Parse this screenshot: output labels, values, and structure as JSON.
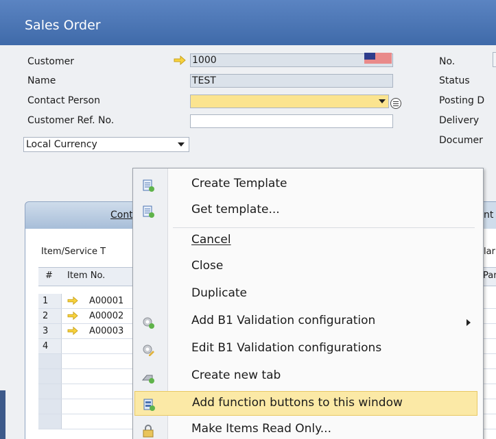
{
  "window": {
    "title": "Sales Order"
  },
  "header": {
    "customer_label": "Customer",
    "customer_value": "1000",
    "name_label": "Name",
    "name_value": "TEST",
    "contact_label": "Contact Person",
    "contact_value": "",
    "custref_label": "Customer Ref. No.",
    "custref_value": "",
    "currency_value": "Local Currency"
  },
  "right": {
    "no_label": "No.",
    "status_label": "Status",
    "posting_label": "Posting D",
    "delivery_label": "Delivery",
    "document_label": "Documer"
  },
  "tabs": {
    "contents_label": "Cont",
    "tab2_label": "nt"
  },
  "grid": {
    "item_service_label": "Item/Service T",
    "col_hash": "#",
    "col_item": "Item No.",
    "right_hdr_1": "lar",
    "right_hdr_2": "Par",
    "rows": [
      {
        "num": "1",
        "item": "A00001"
      },
      {
        "num": "2",
        "item": "A00002"
      },
      {
        "num": "3",
        "item": "A00003"
      },
      {
        "num": "4",
        "item": ""
      }
    ]
  },
  "menu": {
    "items": [
      {
        "label": "Create Template"
      },
      {
        "label": "Get template..."
      },
      {
        "label": "Cancel"
      },
      {
        "label": "Close"
      },
      {
        "label": "Duplicate"
      },
      {
        "label": "Add B1 Validation configuration"
      },
      {
        "label": "Edit B1 Validation configurations"
      },
      {
        "label": "Create new tab"
      },
      {
        "label": "Add function buttons to this window"
      },
      {
        "label": "Make Items Read Only..."
      }
    ],
    "highlight_color": "#fbe9a6"
  }
}
